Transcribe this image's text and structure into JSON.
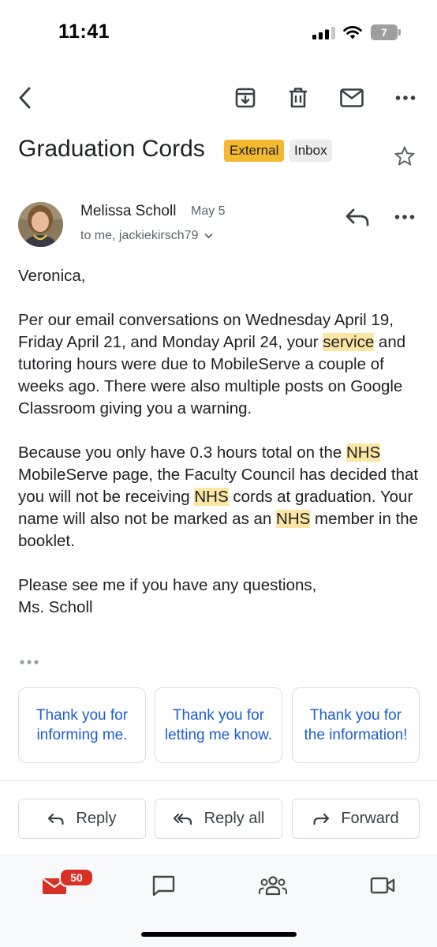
{
  "status_bar": {
    "time": "11:41",
    "battery": "7"
  },
  "toolbar": {
    "back": "back-arrow-icon",
    "archive": "archive-icon",
    "delete": "trash-icon",
    "mark_unread": "mail-icon",
    "more": "more-horizontal-icon"
  },
  "email": {
    "subject": "Graduation Cords",
    "labels": [
      "External",
      "Inbox"
    ],
    "sender": "Melissa Scholl",
    "date": "May 5",
    "recipients": "to me, jackiekirsch79",
    "body": {
      "greeting": "Veronica,",
      "p1": {
        "a": "Per our email conversations on Wednesday April 19, Friday April 21, and Monday April 24, your ",
        "hl": "service",
        "b": " and tutoring hours were due to MobileServe a couple of weeks ago. There were also multiple posts on Google Classroom giving you a warning."
      },
      "p2": {
        "a": "Because you only have 0.3 hours total on the ",
        "hl1": "NHS",
        "b": " MobileServe page, the Faculty Council has decided that you will not be receiving ",
        "hl2": "NHS",
        "c": " cords at graduation. Your name will also not be marked as an ",
        "hl3": "NHS",
        "d": " member in the booklet."
      },
      "closing_1": "Please see me if you have any questions,",
      "closing_2": "Ms. Scholl"
    }
  },
  "smart_replies": [
    "Thank you for informing me.",
    "Thank you for letting me know.",
    "Thank you for the information!"
  ],
  "actions": {
    "reply": "Reply",
    "reply_all": "Reply all",
    "forward": "Forward"
  },
  "bottom_nav": {
    "mail_badge": "50"
  },
  "colors": {
    "accent": "#1a5fd0",
    "badge": "#d93025",
    "external_label": "#f4b931",
    "highlight": "#fbe6a4"
  }
}
